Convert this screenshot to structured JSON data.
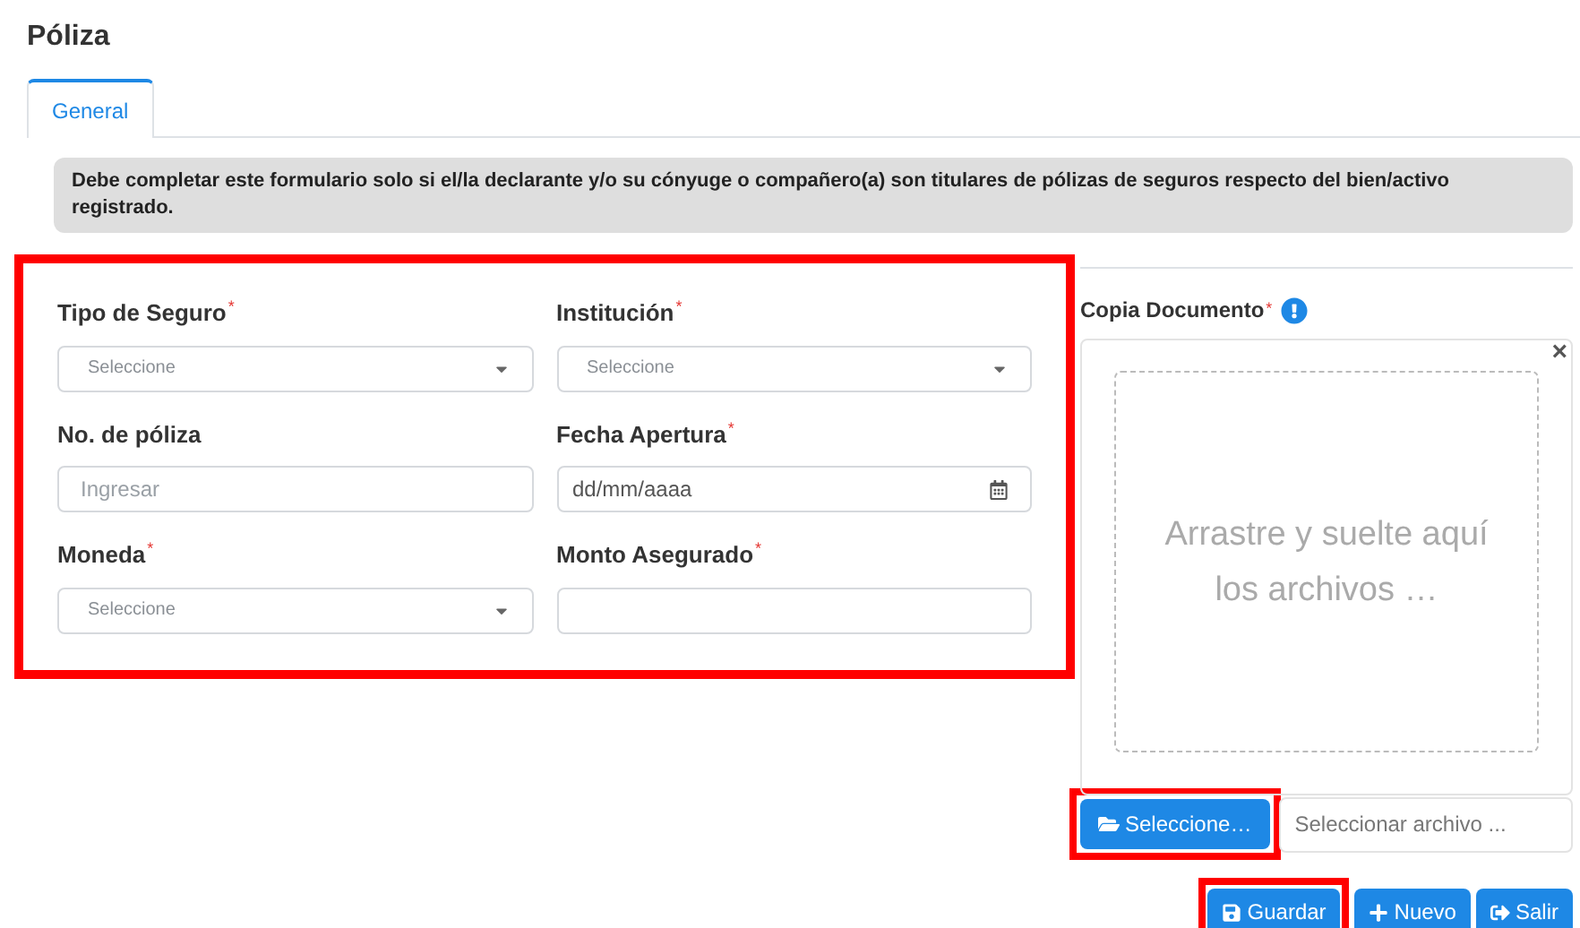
{
  "page_title": "Póliza",
  "tabs": [
    {
      "label": "General",
      "selected": true
    }
  ],
  "notice": "Debe completar este formulario solo si el/la declarante y/o su cónyuge o compañero(a) son titulares de pólizas de seguros respecto del bien/activo registrado.",
  "form": {
    "highlighted": true,
    "fields": [
      {
        "label": "Tipo de Seguro",
        "required_mark": "*",
        "kind": "select",
        "placeholder": "Seleccione"
      },
      {
        "label": "Institución",
        "required_mark": "*",
        "kind": "select",
        "placeholder": "Seleccione"
      },
      {
        "label": "No. de póliza",
        "kind": "text",
        "placeholder": "Ingresar"
      },
      {
        "label": "Fecha Apertura",
        "required_mark": "*",
        "kind": "date",
        "placeholder": "dd/mm/aaaa"
      },
      {
        "label": "Moneda",
        "required_mark": "*",
        "kind": "select",
        "placeholder": "Seleccione"
      },
      {
        "label": "Monto Asegurado",
        "required_mark": "*",
        "kind": "text"
      }
    ]
  },
  "upload": {
    "label": "Copia Documento",
    "required_mark": "*",
    "close": "×",
    "dropzone_text": "Arrastre y suelte aquí los archivos …",
    "browse_button": {
      "label": "Seleccione…",
      "highlighted": true
    },
    "file_field_placeholder": "Seleccionar archivo ..."
  },
  "actions": [
    {
      "label": "Guardar",
      "kind": "save",
      "highlighted": true
    },
    {
      "label": "Nuevo",
      "kind": "new",
      "highlighted": false
    },
    {
      "label": "Salir",
      "kind": "exit",
      "highlighted": false
    }
  ]
}
